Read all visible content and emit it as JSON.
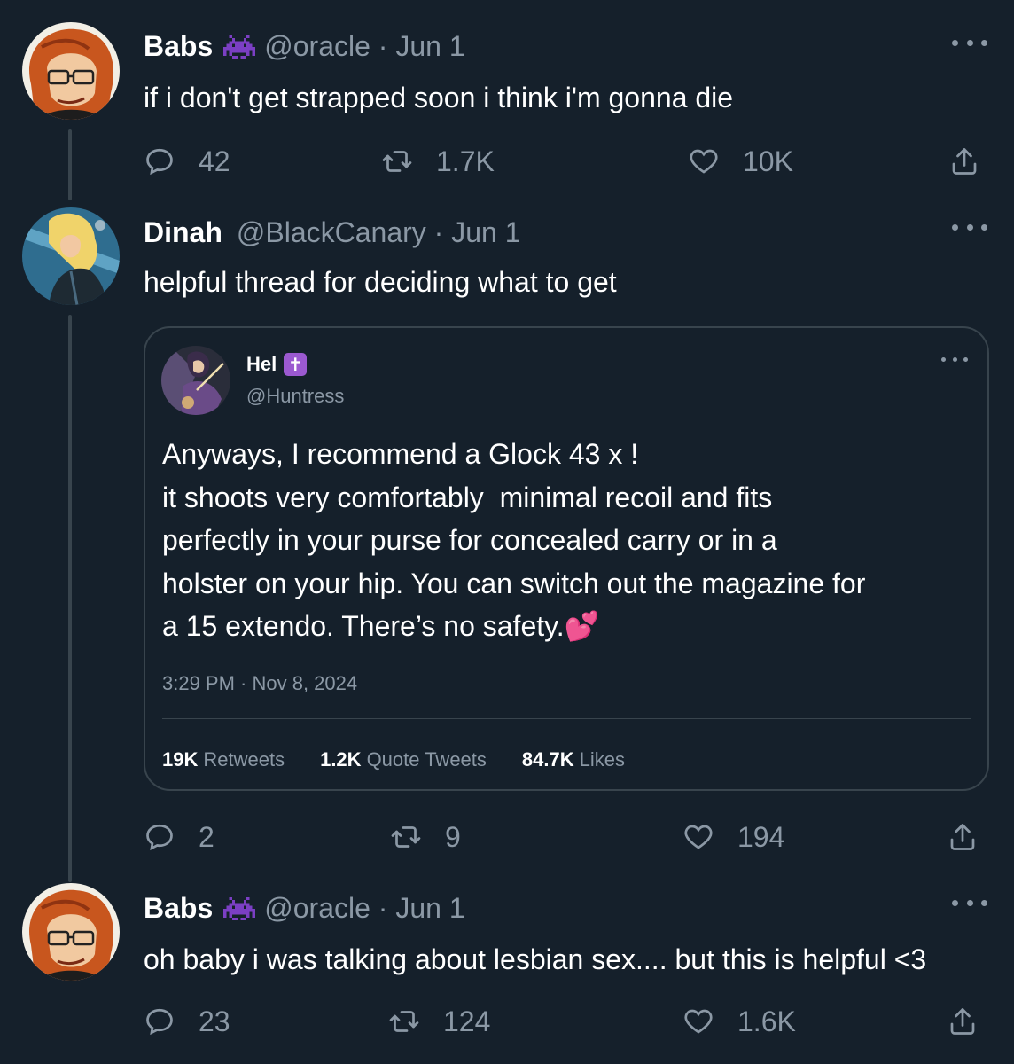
{
  "tweets": [
    {
      "name": "Babs",
      "handle": "@oracle · Jun 1",
      "badge": "space-invader-icon",
      "text": "if i don't get strapped soon i think i'm gonna die",
      "replies": "42",
      "retweets": "1.7K",
      "likes": "10K"
    },
    {
      "name": "Dinah",
      "handle": "@BlackCanary · Jun 1",
      "text": "helpful thread for deciding what to get",
      "replies": "2",
      "retweets": "9",
      "likes": "194"
    },
    {
      "name": "Babs",
      "handle": "@oracle · Jun 1",
      "badge": "space-invader-icon",
      "text": "oh baby i was talking about lesbian sex.... but this is helpful <3",
      "replies": "23",
      "retweets": "124",
      "likes": "1.6K"
    }
  ],
  "quote": {
    "name": "Hel",
    "badge": "✝",
    "handle": "@Huntress",
    "lines": [
      "Anyways, I recommend a Glock 43 x !",
      "it shoots very comfortably  minimal recoil and fits",
      "perfectly in your purse for concealed carry or in a",
      "holster on your hip. You can switch out the magazine for",
      "a 15 extendo. There’s no safety.💕"
    ],
    "time": "3:29 PM · Nov 8, 2024",
    "retweets_count": "19K",
    "retweets_label": "Retweets",
    "quotes_count": "1.2K",
    "quotes_label": "Quote Tweets",
    "likes_count": "84.7K",
    "likes_label": "Likes"
  },
  "colors": {
    "background": "#15202b",
    "secondary_text": "#8b98a5",
    "border": "#38444d",
    "badge_purple": "#7b3fc4"
  }
}
